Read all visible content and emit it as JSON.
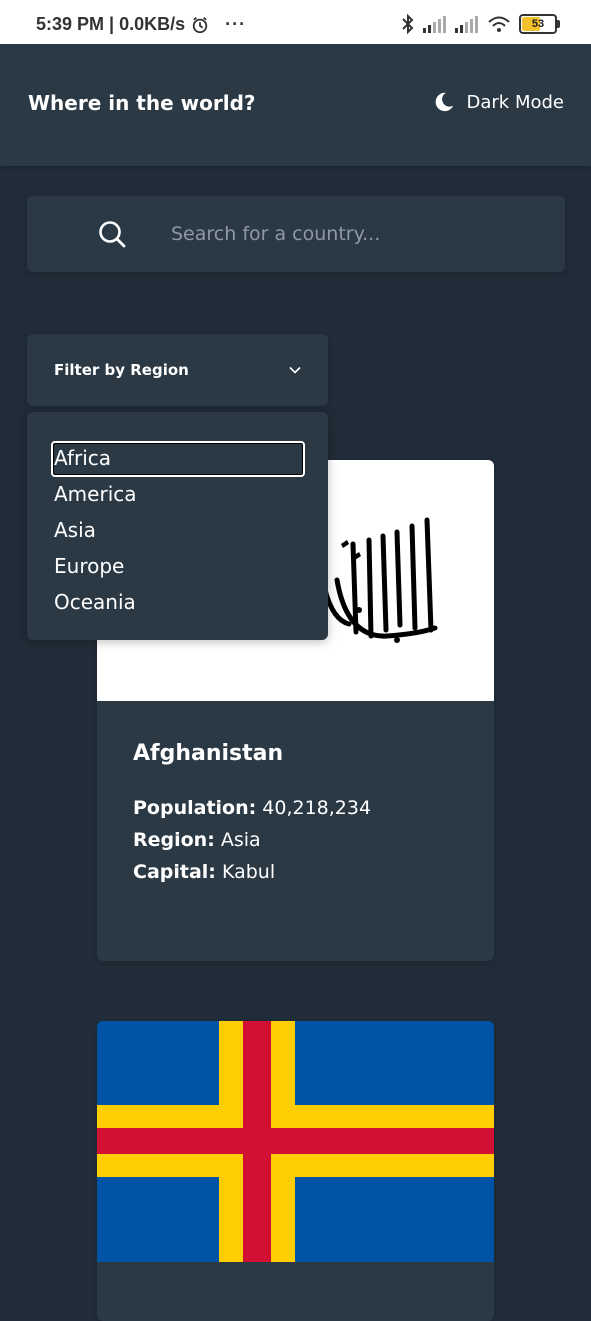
{
  "status_bar": {
    "time_net": "5:39 PM | 0.0KB/s",
    "dots": "···",
    "battery": "53"
  },
  "header": {
    "title": "Where in the world?",
    "dark_mode_label": "Dark Mode"
  },
  "search": {
    "placeholder": "Search for a country..."
  },
  "filter": {
    "label": "Filter by Region",
    "options": [
      "Africa",
      "America",
      "Asia",
      "Europe",
      "Oceania"
    ],
    "highlighted": "Africa"
  },
  "countries": [
    {
      "name": "Afghanistan",
      "population_label": "Population:",
      "population": "40,218,234",
      "region_label": "Region:",
      "region": "Asia",
      "capital_label": "Capital:",
      "capital": "Kabul"
    }
  ],
  "colors": {
    "background": "#202c37",
    "element": "#2b3945",
    "aland_blue": "#0053a5",
    "aland_yellow": "#ffce00",
    "aland_red": "#d21034"
  }
}
